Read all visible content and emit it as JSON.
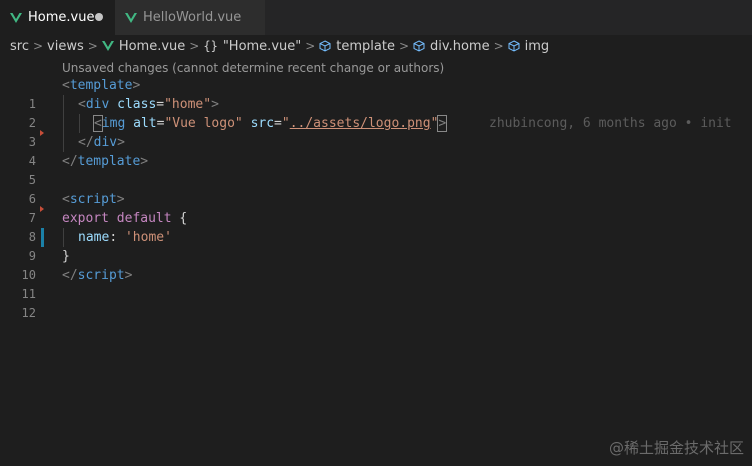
{
  "tabs": [
    {
      "label": "Home.vue",
      "active": true,
      "modified": true
    },
    {
      "label": "HelloWorld.vue",
      "active": false,
      "modified": false
    }
  ],
  "breadcrumb": {
    "items": [
      "src",
      "views",
      "Home.vue",
      "\"Home.vue\"",
      "template",
      "div.home",
      "img"
    ],
    "separator": ">",
    "object_symbol": "{}"
  },
  "codelens": "Unsaved changes (cannot determine recent change or authors)",
  "editor": {
    "line_numbers": [
      "1",
      "2",
      "3",
      "4",
      "5",
      "6",
      "7",
      "8",
      "9",
      "10",
      "11",
      "12"
    ],
    "line3": {
      "open": "<",
      "tag": "img",
      "attr1": "alt",
      "eq1": "=",
      "val1": "\"Vue logo\"",
      "attr2": "src",
      "eq2": "=",
      "val2_q1": "\"",
      "val2_path": "../assets/logo.png",
      "val2_q2": "\"",
      "close": ">"
    },
    "blame": "zhubincong, 6 months ago • init",
    "line1": {
      "open": "<",
      "tag": "template",
      "close": ">"
    },
    "line2": {
      "open": "<",
      "tag": "div",
      "attr": "class",
      "eq": "=",
      "val": "\"home\"",
      "close": ">"
    },
    "line4": {
      "open": "</",
      "tag": "div",
      "close": ">"
    },
    "line5": {
      "open": "</",
      "tag": "template",
      "close": ">"
    },
    "line7": {
      "open": "<",
      "tag": "script",
      "close": ">"
    },
    "line8": {
      "kw1": "export",
      "kw2": "default",
      "brace": "{"
    },
    "line9": {
      "key": "name",
      "colon": ":",
      "val": "'home'"
    },
    "line10": {
      "brace": "}"
    },
    "line11": {
      "open": "</",
      "tag": "script",
      "close": ">"
    }
  },
  "colors": {
    "vue_green": "#41b883",
    "modified_bar": "#1b81a8",
    "deleted_marker": "#c74e39"
  },
  "watermark": "@稀土掘金技术社区"
}
